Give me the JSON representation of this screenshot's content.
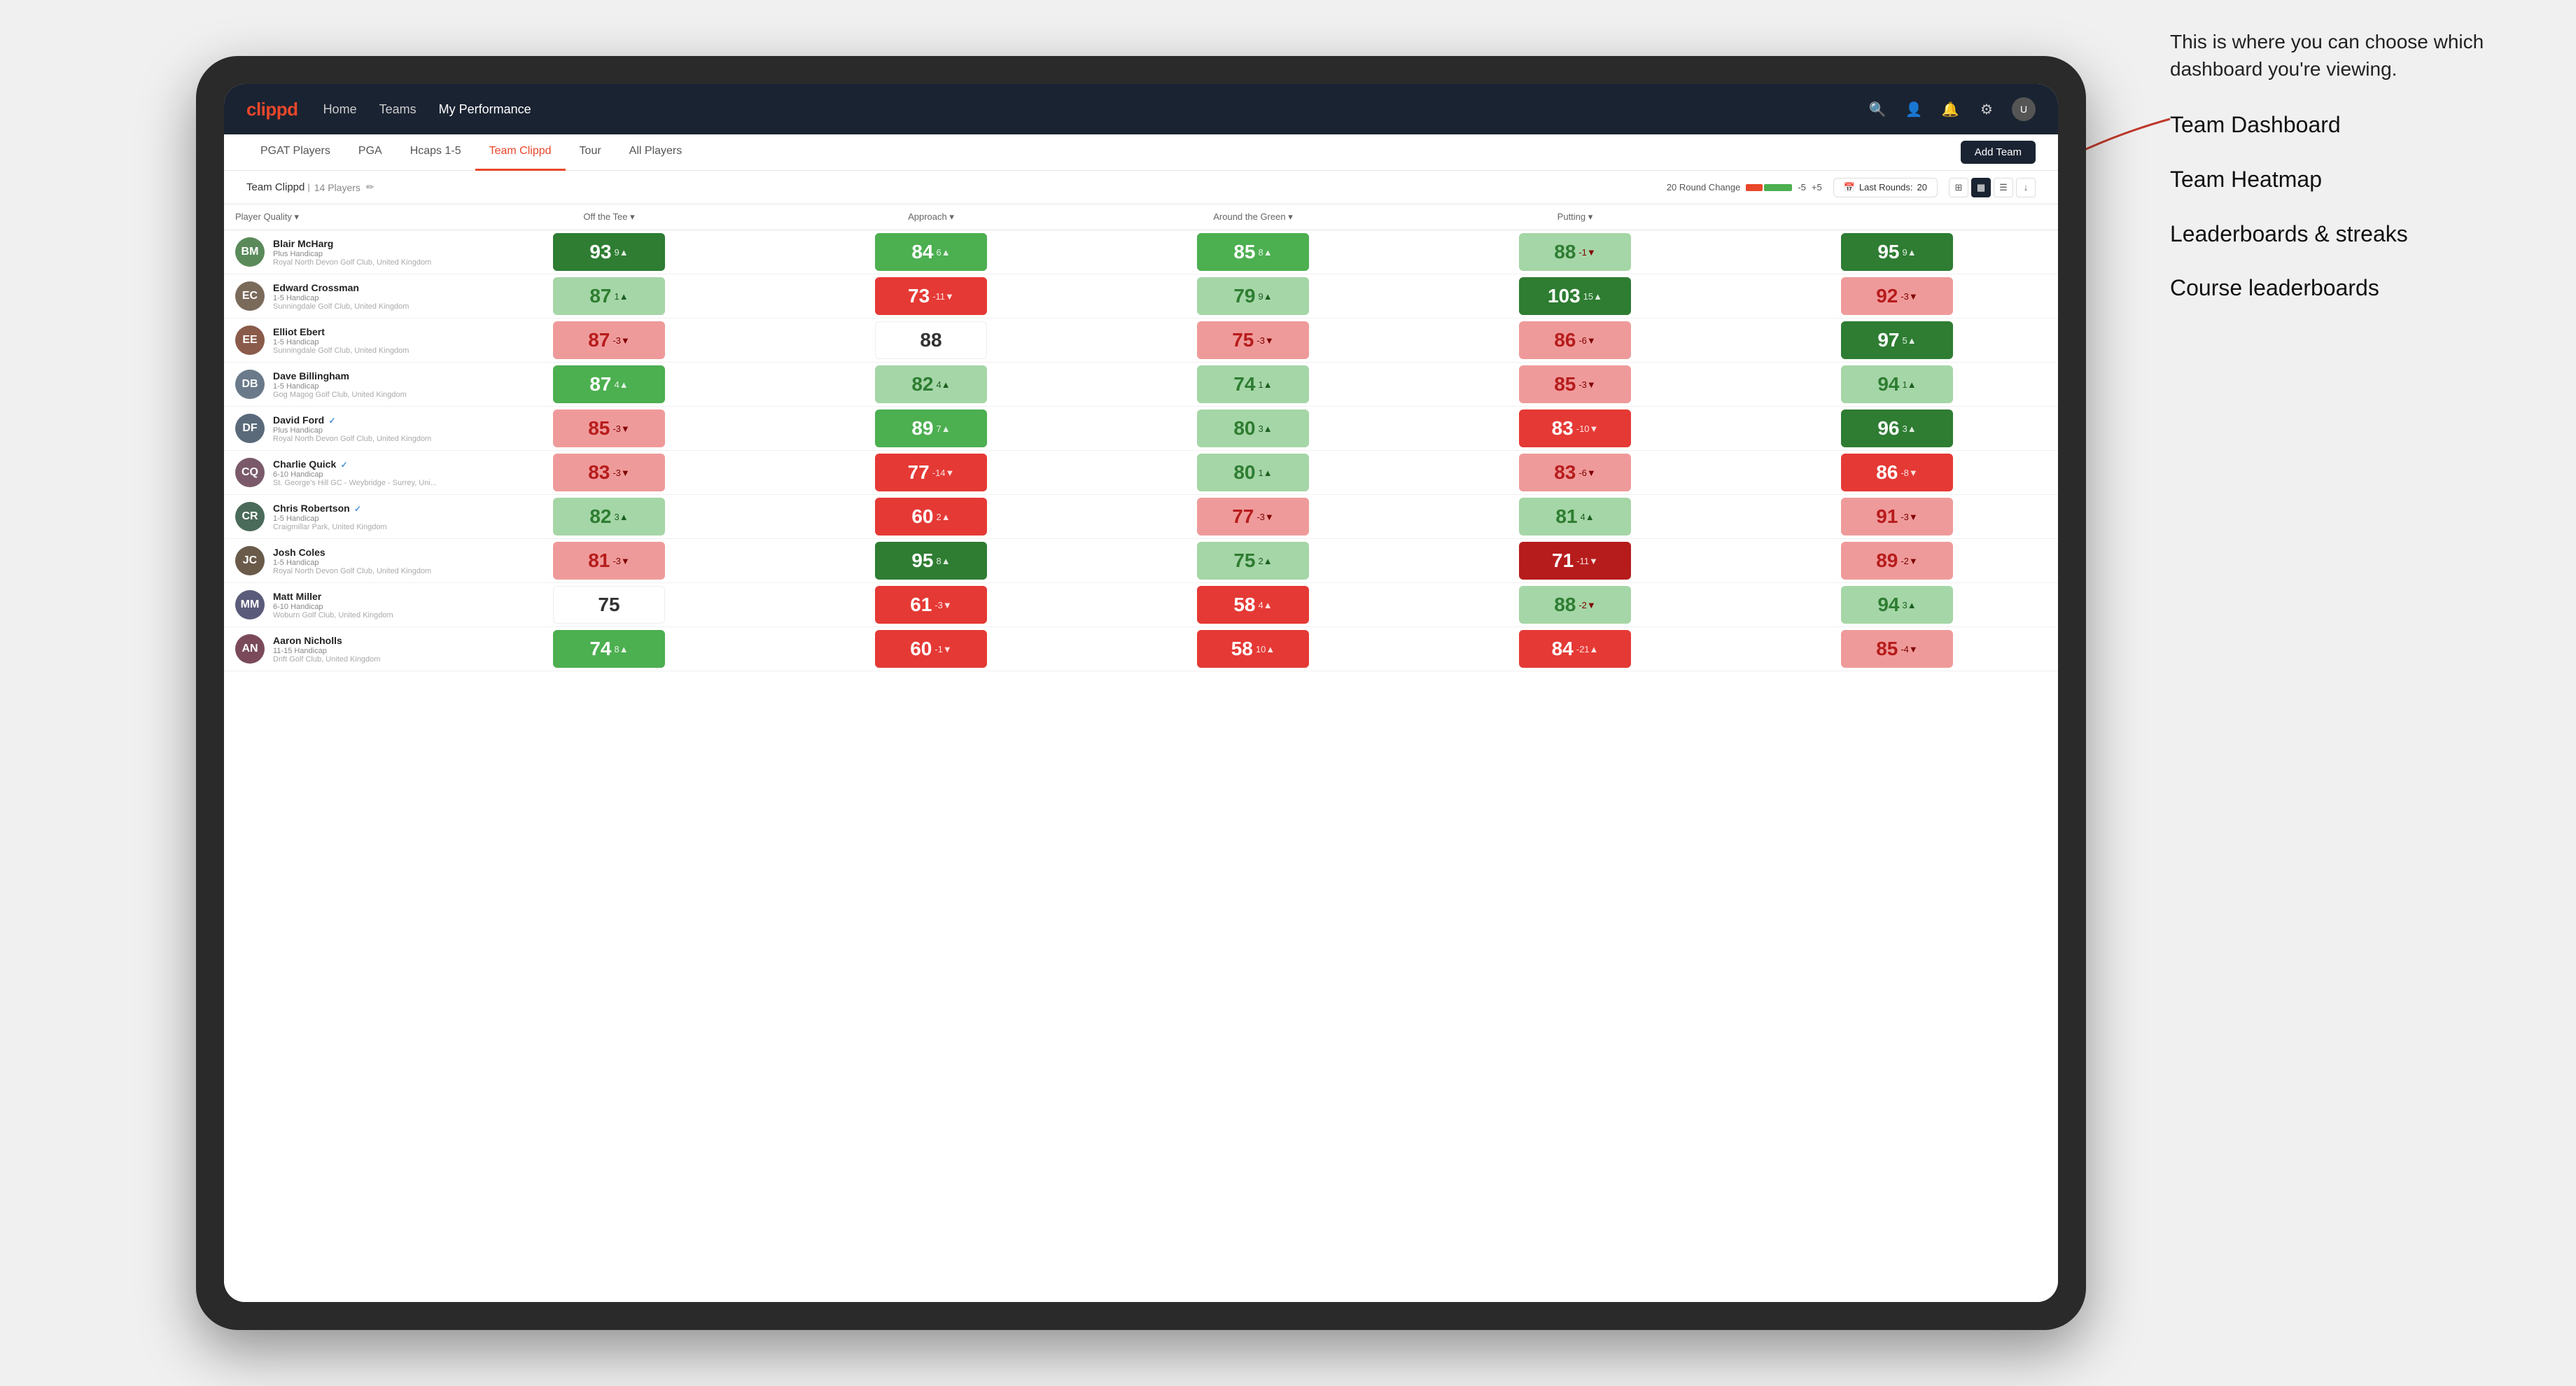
{
  "annotation": {
    "intro": "This is where you can choose which dashboard you're viewing.",
    "items": [
      "Team Dashboard",
      "Team Heatmap",
      "Leaderboards & streaks",
      "Course leaderboards"
    ]
  },
  "nav": {
    "logo": "clippd",
    "links": [
      "Home",
      "Teams",
      "My Performance"
    ],
    "active_link": "My Performance"
  },
  "sub_nav": {
    "links": [
      "PGAT Players",
      "PGA",
      "Hcaps 1-5",
      "Team Clippd",
      "Tour",
      "All Players"
    ],
    "active_link": "Team Clippd",
    "add_team": "Add Team"
  },
  "team_header": {
    "name": "Team Clippd",
    "count": "14 Players",
    "round_change_label": "20 Round Change",
    "neg_val": "-5",
    "pos_val": "+5",
    "last_rounds_label": "Last Rounds:",
    "last_rounds_val": "20"
  },
  "table": {
    "col_headers": [
      "Player Quality ▾",
      "Off the Tee ▾",
      "Approach ▾",
      "Around the Green ▾",
      "Putting ▾"
    ],
    "players": [
      {
        "name": "Blair McHarg",
        "handicap": "Plus Handicap",
        "club": "Royal North Devon Golf Club, United Kingdom",
        "initials": "BM",
        "color": "#5a8a5a",
        "metrics": [
          {
            "score": "93",
            "change": "9▲",
            "bg": "bg-green-strong",
            "change_dir": "up"
          },
          {
            "score": "84",
            "change": "6▲",
            "bg": "bg-green-medium",
            "change_dir": "up"
          },
          {
            "score": "85",
            "change": "8▲",
            "bg": "bg-green-medium",
            "change_dir": "up"
          },
          {
            "score": "88",
            "change": "-1▼",
            "bg": "bg-green-light",
            "change_dir": "down"
          },
          {
            "score": "95",
            "change": "9▲",
            "bg": "bg-green-strong",
            "change_dir": "up"
          }
        ]
      },
      {
        "name": "Edward Crossman",
        "handicap": "1-5 Handicap",
        "club": "Sunningdale Golf Club, United Kingdom",
        "initials": "EC",
        "color": "#7a6a5a",
        "metrics": [
          {
            "score": "87",
            "change": "1▲",
            "bg": "bg-green-light",
            "change_dir": "up"
          },
          {
            "score": "73",
            "change": "-11▼",
            "bg": "bg-red-medium",
            "change_dir": "down"
          },
          {
            "score": "79",
            "change": "9▲",
            "bg": "bg-green-light",
            "change_dir": "up"
          },
          {
            "score": "103",
            "change": "15▲",
            "bg": "bg-green-strong",
            "change_dir": "up"
          },
          {
            "score": "92",
            "change": "-3▼",
            "bg": "bg-red-light",
            "change_dir": "down"
          }
        ]
      },
      {
        "name": "Elliot Ebert",
        "handicap": "1-5 Handicap",
        "club": "Sunningdale Golf Club, United Kingdom",
        "initials": "EE",
        "color": "#8a5a4a",
        "metrics": [
          {
            "score": "87",
            "change": "-3▼",
            "bg": "bg-red-light",
            "change_dir": "down"
          },
          {
            "score": "88",
            "change": "",
            "bg": "bg-white",
            "change_dir": ""
          },
          {
            "score": "75",
            "change": "-3▼",
            "bg": "bg-red-light",
            "change_dir": "down"
          },
          {
            "score": "86",
            "change": "-6▼",
            "bg": "bg-red-light",
            "change_dir": "down"
          },
          {
            "score": "97",
            "change": "5▲",
            "bg": "bg-green-strong",
            "change_dir": "up"
          }
        ]
      },
      {
        "name": "Dave Billingham",
        "handicap": "1-5 Handicap",
        "club": "Gog Magog Golf Club, United Kingdom",
        "initials": "DB",
        "color": "#6a7a8a",
        "metrics": [
          {
            "score": "87",
            "change": "4▲",
            "bg": "bg-green-medium",
            "change_dir": "up"
          },
          {
            "score": "82",
            "change": "4▲",
            "bg": "bg-green-light",
            "change_dir": "up"
          },
          {
            "score": "74",
            "change": "1▲",
            "bg": "bg-green-light",
            "change_dir": "up"
          },
          {
            "score": "85",
            "change": "-3▼",
            "bg": "bg-red-light",
            "change_dir": "down"
          },
          {
            "score": "94",
            "change": "1▲",
            "bg": "bg-green-light",
            "change_dir": "up"
          }
        ]
      },
      {
        "name": "David Ford",
        "handicap": "Plus Handicap",
        "club": "Royal North Devon Golf Club, United Kingdom",
        "initials": "DF",
        "color": "#5a6a7a",
        "verified": true,
        "metrics": [
          {
            "score": "85",
            "change": "-3▼",
            "bg": "bg-red-light",
            "change_dir": "down"
          },
          {
            "score": "89",
            "change": "7▲",
            "bg": "bg-green-medium",
            "change_dir": "up"
          },
          {
            "score": "80",
            "change": "3▲",
            "bg": "bg-green-light",
            "change_dir": "up"
          },
          {
            "score": "83",
            "change": "-10▼",
            "bg": "bg-red-medium",
            "change_dir": "down"
          },
          {
            "score": "96",
            "change": "3▲",
            "bg": "bg-green-strong",
            "change_dir": "up"
          }
        ]
      },
      {
        "name": "Charlie Quick",
        "handicap": "6-10 Handicap",
        "club": "St. George's Hill GC - Weybridge - Surrey, Uni...",
        "initials": "CQ",
        "color": "#7a5a6a",
        "verified": true,
        "metrics": [
          {
            "score": "83",
            "change": "-3▼",
            "bg": "bg-red-light",
            "change_dir": "down"
          },
          {
            "score": "77",
            "change": "-14▼",
            "bg": "bg-red-medium",
            "change_dir": "down"
          },
          {
            "score": "80",
            "change": "1▲",
            "bg": "bg-green-light",
            "change_dir": "up"
          },
          {
            "score": "83",
            "change": "-6▼",
            "bg": "bg-red-light",
            "change_dir": "down"
          },
          {
            "score": "86",
            "change": "-8▼",
            "bg": "bg-red-medium",
            "change_dir": "down"
          }
        ]
      },
      {
        "name": "Chris Robertson",
        "handicap": "1-5 Handicap",
        "club": "Craigmillar Park, United Kingdom",
        "initials": "CR",
        "color": "#4a6a5a",
        "verified": true,
        "metrics": [
          {
            "score": "82",
            "change": "3▲",
            "bg": "bg-green-light",
            "change_dir": "up"
          },
          {
            "score": "60",
            "change": "2▲",
            "bg": "bg-red-medium",
            "change_dir": "up"
          },
          {
            "score": "77",
            "change": "-3▼",
            "bg": "bg-red-light",
            "change_dir": "down"
          },
          {
            "score": "81",
            "change": "4▲",
            "bg": "bg-green-light",
            "change_dir": "up"
          },
          {
            "score": "91",
            "change": "-3▼",
            "bg": "bg-red-light",
            "change_dir": "down"
          }
        ]
      },
      {
        "name": "Josh Coles",
        "handicap": "1-5 Handicap",
        "club": "Royal North Devon Golf Club, United Kingdom",
        "initials": "JC",
        "color": "#6a5a4a",
        "metrics": [
          {
            "score": "81",
            "change": "-3▼",
            "bg": "bg-red-light",
            "change_dir": "down"
          },
          {
            "score": "95",
            "change": "8▲",
            "bg": "bg-green-strong",
            "change_dir": "up"
          },
          {
            "score": "75",
            "change": "2▲",
            "bg": "bg-green-light",
            "change_dir": "up"
          },
          {
            "score": "71",
            "change": "-11▼",
            "bg": "bg-red-strong",
            "change_dir": "down"
          },
          {
            "score": "89",
            "change": "-2▼",
            "bg": "bg-red-light",
            "change_dir": "down"
          }
        ]
      },
      {
        "name": "Matt Miller",
        "handicap": "6-10 Handicap",
        "club": "Woburn Golf Club, United Kingdom",
        "initials": "MM",
        "color": "#5a5a7a",
        "metrics": [
          {
            "score": "75",
            "change": "",
            "bg": "bg-white",
            "change_dir": ""
          },
          {
            "score": "61",
            "change": "-3▼",
            "bg": "bg-red-medium",
            "change_dir": "down"
          },
          {
            "score": "58",
            "change": "4▲",
            "bg": "bg-red-medium",
            "change_dir": "up"
          },
          {
            "score": "88",
            "change": "-2▼",
            "bg": "bg-green-light",
            "change_dir": "down"
          },
          {
            "score": "94",
            "change": "3▲",
            "bg": "bg-green-light",
            "change_dir": "up"
          }
        ]
      },
      {
        "name": "Aaron Nicholls",
        "handicap": "11-15 Handicap",
        "club": "Drift Golf Club, United Kingdom",
        "initials": "AN",
        "color": "#7a4a5a",
        "metrics": [
          {
            "score": "74",
            "change": "8▲",
            "bg": "bg-green-medium",
            "change_dir": "up"
          },
          {
            "score": "60",
            "change": "-1▼",
            "bg": "bg-red-medium",
            "change_dir": "down"
          },
          {
            "score": "58",
            "change": "10▲",
            "bg": "bg-red-medium",
            "change_dir": "up"
          },
          {
            "score": "84",
            "change": "-21▲",
            "bg": "bg-red-medium",
            "change_dir": "down"
          },
          {
            "score": "85",
            "change": "-4▼",
            "bg": "bg-red-light",
            "change_dir": "down"
          }
        ]
      }
    ]
  }
}
